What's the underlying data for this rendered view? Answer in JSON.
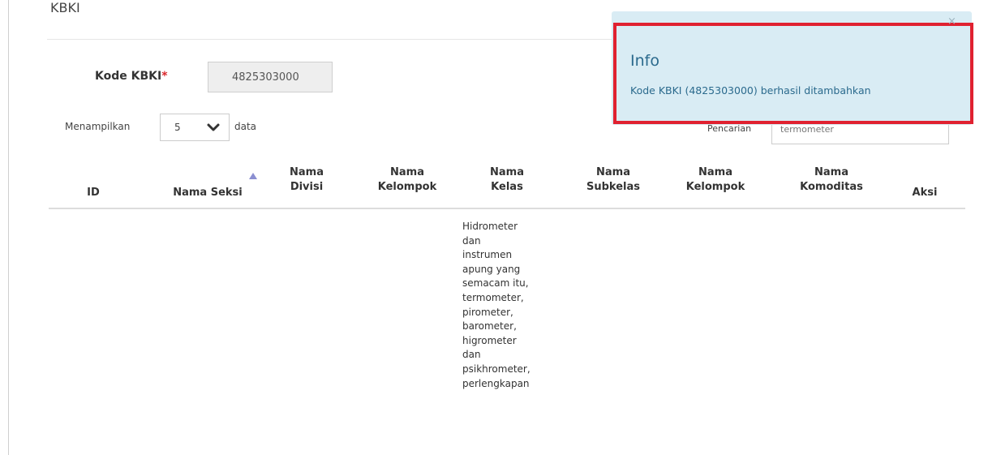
{
  "page": {
    "title": "KBKI"
  },
  "form": {
    "kode_label": "Kode KBKI",
    "required_mark": "*",
    "kode_value": "4825303000"
  },
  "table_controls": {
    "show_prefix": "Menampilkan",
    "page_length": "5",
    "show_suffix": "data",
    "search_label": "Pencarian",
    "search_value": "termometer"
  },
  "table": {
    "columns": [
      "ID",
      "Nama Seksi",
      "Nama\nDivisi",
      "Nama\nKelompok",
      "Nama\nKelas",
      "Nama\nSubkelas",
      "Nama\nKelompok",
      "Nama\nKomoditas",
      "Aksi"
    ],
    "sorted_column": "Nama Seksi",
    "sort_direction": "ascending",
    "rows": [
      {
        "nama_kelas": "Hidrometer\ndan\ninstrumen\napung yang\nsemacam itu,\ntermometer,\npirometer,\nbarometer,\nhigrometer\ndan\npsikhrometer,\nperlengkapan"
      }
    ]
  },
  "toast": {
    "title": "Info",
    "message": "Kode KBKI (4825303000) berhasil ditambahkan",
    "close_glyph": "×",
    "background_color": "#d9ecf4",
    "highlight_color": "#e02130"
  },
  "icons": {
    "select_chevron": "chevron-down-icon",
    "sort_indicator": "sort-asc-icon",
    "close": "close-icon"
  }
}
